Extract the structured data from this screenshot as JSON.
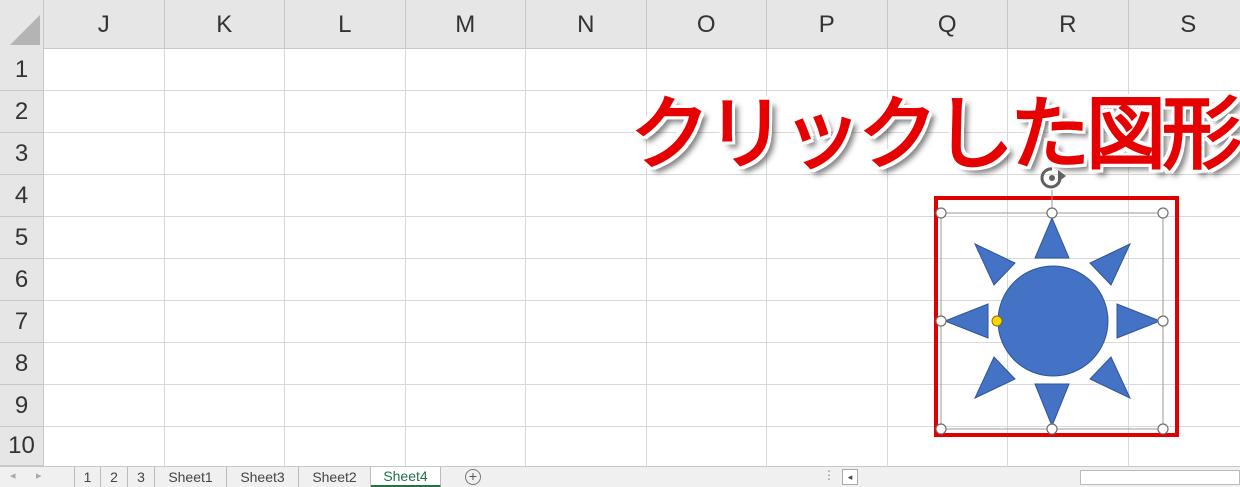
{
  "columns": [
    "J",
    "K",
    "L",
    "M",
    "N",
    "O",
    "P",
    "Q",
    "R",
    "S"
  ],
  "rows": [
    "1",
    "2",
    "3",
    "4",
    "5",
    "6",
    "7",
    "8",
    "9",
    "10"
  ],
  "annotation": {
    "text": "クリックした図形",
    "color": "#e60000"
  },
  "shape": {
    "type": "sun",
    "fill": "#4472c4",
    "highlight_color": "#e00000",
    "adjust_handle_color": "#ffd700"
  },
  "sheet_tabs": [
    {
      "label": "1",
      "active": false
    },
    {
      "label": "2",
      "active": false
    },
    {
      "label": "3",
      "active": false
    },
    {
      "label": "Sheet1",
      "active": false
    },
    {
      "label": "Sheet3",
      "active": false
    },
    {
      "label": "Sheet2",
      "active": false
    },
    {
      "label": "Sheet4",
      "active": true
    }
  ],
  "icons": {
    "prev_sheet": "◂",
    "next_sheet": "▸",
    "add_sheet": "+",
    "more": "⋮",
    "scroll_left": "◂",
    "rotate": "rotate-handle-icon"
  }
}
